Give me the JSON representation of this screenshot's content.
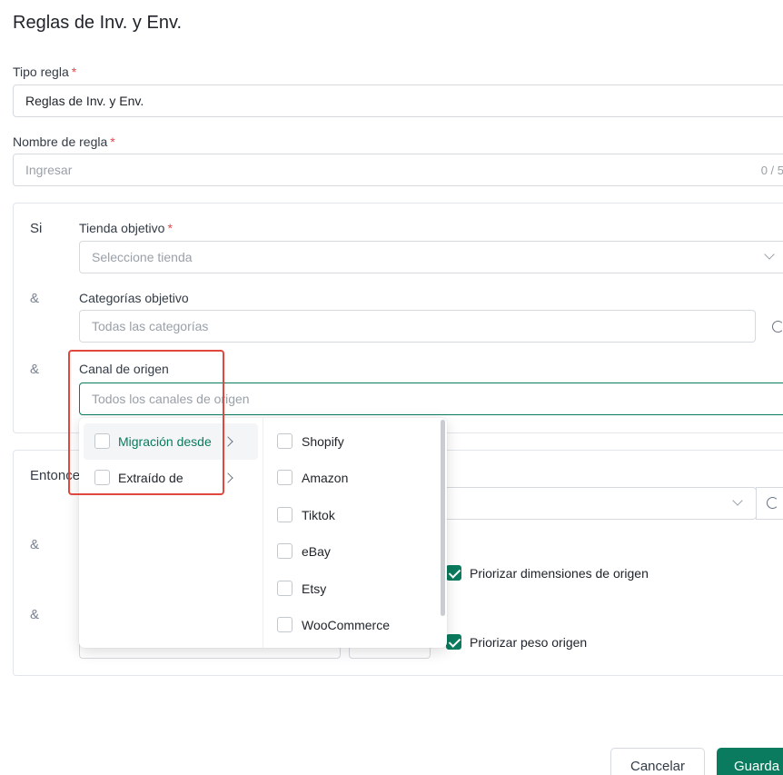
{
  "page": {
    "title": "Reglas de Inv. y Env."
  },
  "form": {
    "rule_type": {
      "label": "Tipo regla",
      "required": "*",
      "value": "Reglas de Inv. y Env."
    },
    "rule_name": {
      "label": "Nombre de regla",
      "required": "*",
      "placeholder": "Ingresar",
      "counter": "0 / 5"
    }
  },
  "if_section": {
    "side_label": "Si",
    "amp": "&",
    "target_store": {
      "label": "Tienda objetivo",
      "required": "*",
      "placeholder": "Seleccione tienda"
    },
    "target_categories": {
      "label": "Categorías objetivo",
      "placeholder": "Todas las categorías"
    },
    "source_channel": {
      "label": "Canal de origen",
      "placeholder": "Todos los canales de origen"
    }
  },
  "then_section": {
    "side_label": "Entonce",
    "amp": "&",
    "prioritize_dimensions": {
      "label": "Priorizar dimensiones de origen",
      "checked": true
    },
    "prioritize_weight": {
      "label": "Priorizar peso origen",
      "checked": true
    }
  },
  "dropdown": {
    "left_options": [
      {
        "label": "Migración desde",
        "active": true
      },
      {
        "label": "Extraído de",
        "active": false
      }
    ],
    "right_options": [
      "Shopify",
      "Amazon",
      "Tiktok",
      "eBay",
      "Etsy",
      "WooCommerce"
    ]
  },
  "footer": {
    "cancel_label": "Cancelar",
    "save_label": "Guarda"
  },
  "colors": {
    "primary": "#0a7b5e",
    "required": "#e5484d",
    "highlight_box": "#e0483e"
  }
}
